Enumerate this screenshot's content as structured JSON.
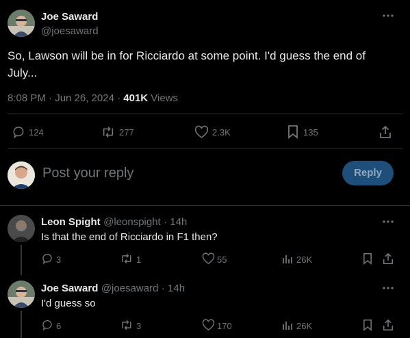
{
  "main_tweet": {
    "author_name": "Joe Saward",
    "author_handle": "@joesaward",
    "text_line1": "So, Lawson will be in for Ricciardo at some point. I'd guess the end of",
    "text_line2": "July...",
    "time": "8:08 PM · Jun 26, 2024 · ",
    "views_count": "401K",
    "views_label": " Views",
    "stats": {
      "replies": "124",
      "reposts": "277",
      "likes": "2.3K",
      "bookmarks": "135"
    }
  },
  "reply_box": {
    "placeholder": "Post your reply",
    "button_label": "Reply"
  },
  "replies": [
    {
      "author_name": "Leon Spight",
      "author_handle": "@leonspight",
      "time": "· 14h",
      "text": "Is that the end of Ricciardo in F1 then?",
      "stats": {
        "replies": "3",
        "reposts": "1",
        "likes": "55",
        "views": "26K"
      }
    },
    {
      "author_name": "Joe Saward",
      "author_handle": "@joesaward",
      "time": "· 14h",
      "text": "I'd guess so",
      "stats": {
        "replies": "6",
        "reposts": "3",
        "likes": "170",
        "views": "26K"
      }
    }
  ],
  "colors": {
    "background": "#000000",
    "text": "#e7e9ea",
    "muted": "#71767b",
    "accent": "#1d9bf0",
    "divider": "#2f3336"
  }
}
